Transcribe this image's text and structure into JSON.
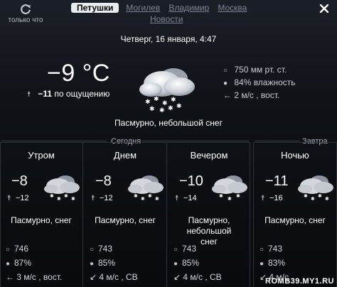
{
  "refresh": {
    "label": "только что",
    "icon": "refresh-icon"
  },
  "tabs": [
    {
      "label": "Петушки",
      "active": true
    },
    {
      "label": "Могилев"
    },
    {
      "label": "Владимир"
    },
    {
      "label": "Москва"
    },
    {
      "label": "Новости"
    }
  ],
  "datetime": "Четверг, 16 января, 4:47",
  "current": {
    "temp": "−9 °C",
    "feels": "−11",
    "feels_label": "по ощущению",
    "description": "Пасмурно, небольшой снег",
    "pressure": "750 мм рт. ст.",
    "humidity": "84% влажность",
    "wind": "← 2 м/с , вост."
  },
  "sections": {
    "today": "Сегодня",
    "tomorrow": "Завтра"
  },
  "periods": [
    {
      "title": "Утром",
      "temp": "−8",
      "feels": "−12",
      "desc": "Пасмурно, снег",
      "pressure": "746",
      "humidity": "87%",
      "wind": "← 3 м/с , вост."
    },
    {
      "title": "Днем",
      "temp": "−8",
      "feels": "−12",
      "desc": "Пасмурно, снег",
      "pressure": "743",
      "humidity": "85%",
      "wind": "↙ 4 м/с , СВ"
    },
    {
      "title": "Вечером",
      "temp": "−10",
      "feels": "−14",
      "desc": "Пасмурно, небольшой снег",
      "pressure": "743",
      "humidity": "85%",
      "wind": "↙ 4 м/с , СВ"
    },
    {
      "title": "Ночью",
      "temp": "−11",
      "feels": "−16",
      "desc": "Пасмурно, снег",
      "pressure": "743",
      "humidity": "83%",
      "wind": "↙ 4 м/с"
    }
  ],
  "watermark": "ROMB39.MY1.RU",
  "colors": {
    "background": "#0f1217",
    "active_tab": "#e9ecef",
    "inactive_tab": "#7c8494"
  }
}
